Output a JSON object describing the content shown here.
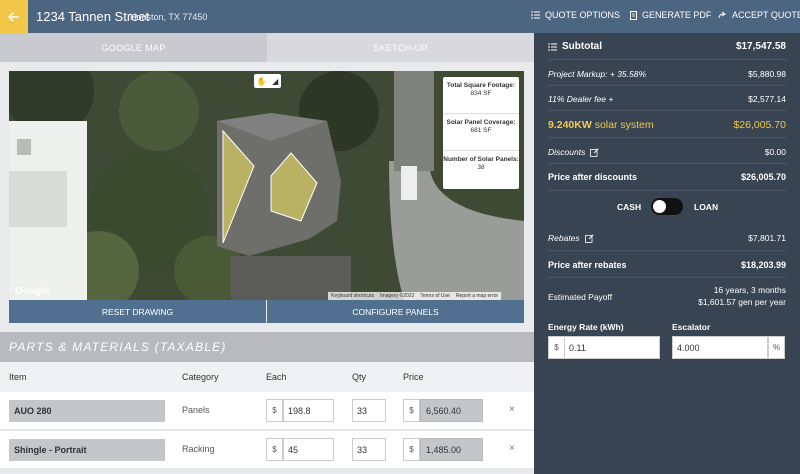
{
  "header": {
    "address": "1234 Tannen Street",
    "city": "Houston, TX 77450",
    "actions": [
      {
        "label": "QUOTE OPTIONS",
        "icon": "list-icon"
      },
      {
        "label": "GENERATE PDF",
        "icon": "document-icon"
      },
      {
        "label": "ACCEPT QUOTE",
        "icon": "share-icon"
      }
    ]
  },
  "tabs": [
    {
      "label": "GOOGLE MAP",
      "active": true
    },
    {
      "label": "SKETCH-UP",
      "active": false
    }
  ],
  "map": {
    "stats": [
      {
        "label": "Total Square Footage:",
        "value": "834",
        "unit": "SF"
      },
      {
        "label": "Solar Panel Coverage:",
        "value": "681",
        "unit": "SF"
      },
      {
        "label": "Number of Solar Panels:",
        "value": "38",
        "unit": ""
      }
    ],
    "logo": "Google",
    "footer": [
      "Keyboard shortcuts",
      "Imagery ©2022",
      "Terms of Use",
      "Report a map error"
    ],
    "buttons": {
      "reset": "RESET DRAWING",
      "configure": "CONFIGURE PANELS"
    }
  },
  "parts": {
    "title": "PARTS & MATERIALS (TAXABLE)",
    "columns": [
      "Item",
      "Category",
      "Each",
      "Qty",
      "Price"
    ],
    "currency": "$",
    "rows": [
      {
        "item": "AUO 280",
        "category": "Panels",
        "each": "198.8",
        "qty": "33",
        "price": "6,560.40"
      },
      {
        "item": "Shingle - Portrait",
        "category": "Racking",
        "each": "45",
        "qty": "33",
        "price": "1,485.00"
      }
    ],
    "delete_glyph": "×"
  },
  "summary": {
    "subtotal_label": "Subtotal",
    "subtotal": "$17,547.58",
    "markup_label": "Project Markup: + 35.58%",
    "markup": "$5,880.98",
    "dealer_label": "11% Dealer fee +",
    "dealer": "$2,577.14",
    "system_kw": "9.240KW",
    "system_label": "solar system",
    "system_price": "$26,005.70",
    "discounts_label": "Discounts",
    "discounts": "$0.00",
    "after_discounts_label": "Price after discounts",
    "after_discounts": "$26,005.70",
    "cash_label": "CASH",
    "loan_label": "LOAN",
    "rebates_label": "Rebates",
    "rebates": "$7,801.71",
    "after_rebates_label": "Price after rebates",
    "after_rebates": "$18,203.99",
    "payoff_label": "Estimated Payoff",
    "payoff_time": "16 years, 3 months",
    "payoff_gen": "$1,601.57 gen per year",
    "energy_rate_label": "Energy Rate (kWh)",
    "energy_rate_prefix": "$",
    "energy_rate": "0.11",
    "escalator_label": "Escalator",
    "escalator": "4.000",
    "escalator_suffix": "%"
  },
  "colors": {
    "header": "#4c6581",
    "accent": "#f2c84b",
    "panel": "#384452",
    "button": "#51708f"
  }
}
